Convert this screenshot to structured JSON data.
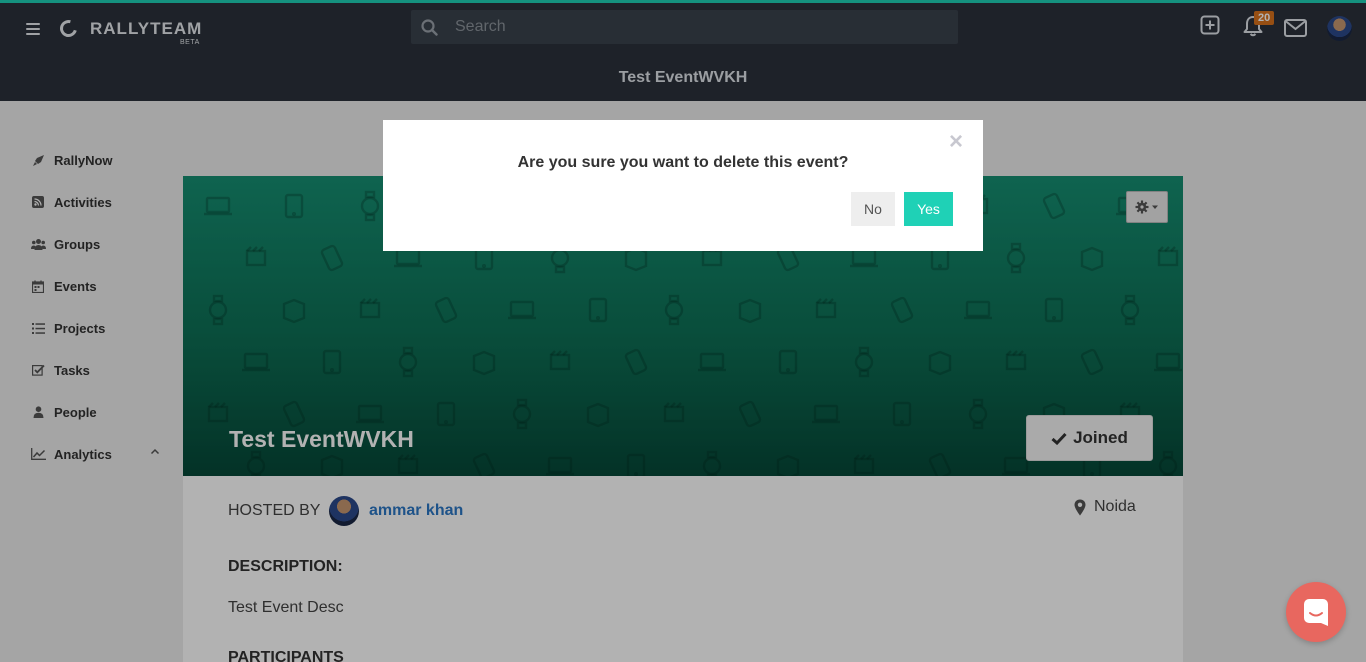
{
  "app": {
    "logo_text": "RALLYTEAM",
    "logo_badge": "BETA",
    "search_placeholder": "Search",
    "notification_count": "20",
    "accent_color": "#1fd1b6"
  },
  "page_title": "Test EventWVKH",
  "sidebar": {
    "items": [
      {
        "label": "RallyNow",
        "icon": "rocket-icon"
      },
      {
        "label": "Activities",
        "icon": "rss-icon"
      },
      {
        "label": "Groups",
        "icon": "users-icon"
      },
      {
        "label": "Events",
        "icon": "calendar-icon"
      },
      {
        "label": "Projects",
        "icon": "list-icon"
      },
      {
        "label": "Tasks",
        "icon": "checkbox-icon"
      },
      {
        "label": "People",
        "icon": "user-icon"
      },
      {
        "label": "Analytics",
        "icon": "line-chart-icon"
      }
    ]
  },
  "event": {
    "title": "Test EventWVKH",
    "joined_label": "Joined",
    "hosted_by_label": "HOSTED BY",
    "host_name": "ammar khan",
    "location": "Noida",
    "description_label": "DESCRIPTION:",
    "description": "Test Event Desc",
    "participants_label": "PARTICIPANTS"
  },
  "modal": {
    "question": "Are you sure you want to delete this event?",
    "no_label": "No",
    "yes_label": "Yes",
    "close_symbol": "×"
  }
}
